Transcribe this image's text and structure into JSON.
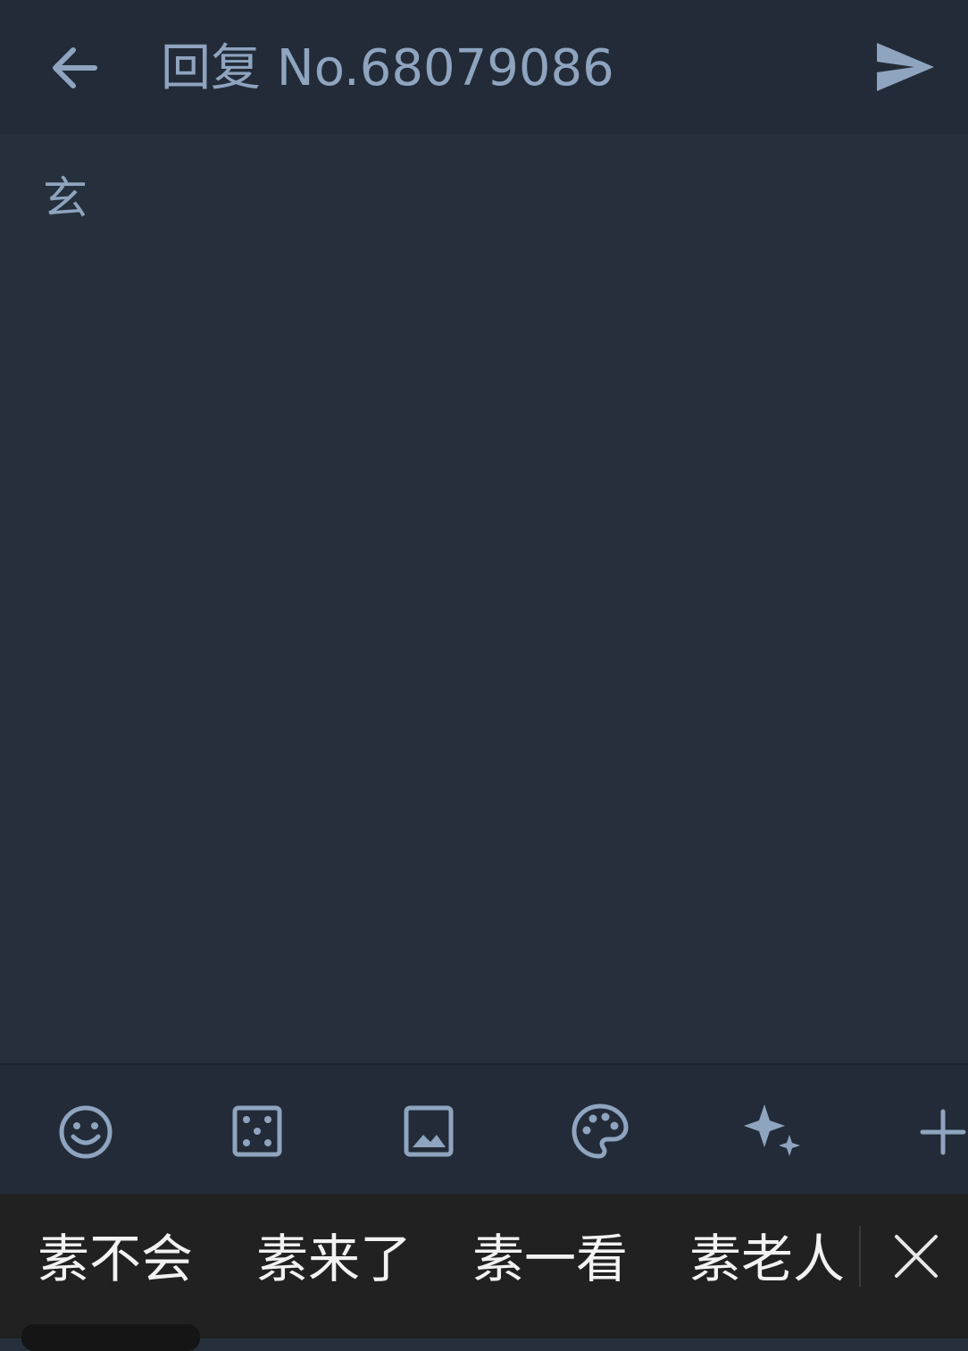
{
  "header": {
    "back_icon": "arrow-left-icon",
    "title": "回复 No.68079086",
    "send_icon": "send-icon"
  },
  "editor": {
    "content": "玄"
  },
  "toolbar": {
    "tools": [
      {
        "name": "emoji",
        "icon": "smiley-icon"
      },
      {
        "name": "dice",
        "icon": "dice-icon"
      },
      {
        "name": "image",
        "icon": "image-icon"
      },
      {
        "name": "palette",
        "icon": "palette-icon"
      },
      {
        "name": "sparkle",
        "icon": "sparkle-icon"
      },
      {
        "name": "more",
        "icon": "plus-icon"
      }
    ]
  },
  "suggestions": {
    "items": [
      "素不会",
      "素来了",
      "素一看",
      "素老人"
    ],
    "close_icon": "close-icon"
  },
  "colors": {
    "background": "#26303d",
    "bar": "#222b37",
    "accent": "#8ea4bf",
    "keyboard": "#212121"
  }
}
